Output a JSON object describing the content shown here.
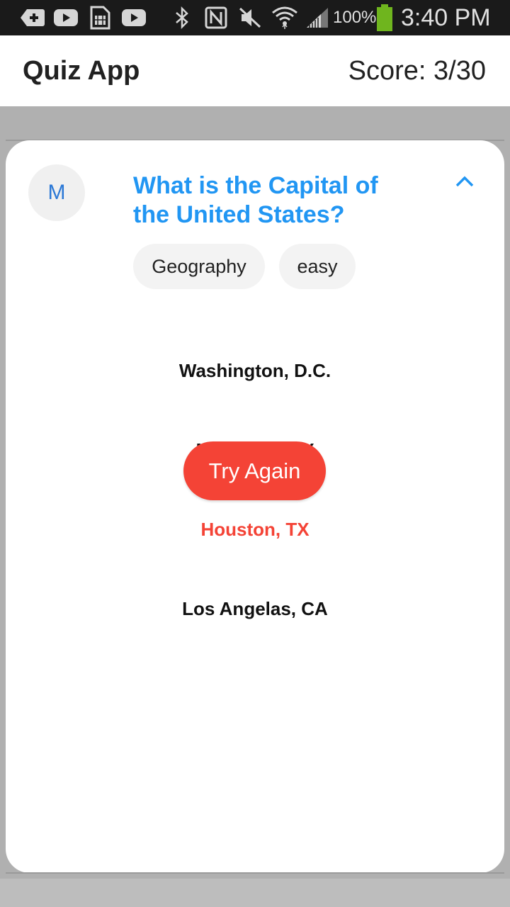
{
  "status_bar": {
    "icons": [
      "add-notification-icon",
      "youtube-icon",
      "sim-card-icon",
      "youtube-icon",
      "bluetooth-icon",
      "nfc-icon",
      "mute-icon",
      "wifi-icon",
      "signal-icon",
      "battery-icon"
    ],
    "battery_percent": "100%",
    "time": "3:40 PM"
  },
  "app_bar": {
    "title": "Quiz App",
    "score": "Score: 3/30"
  },
  "card": {
    "avatar_letter": "M",
    "question": "What is the Capital of the United States?",
    "chips": [
      "Geography",
      "easy"
    ],
    "answers": [
      "Washington, D.C.",
      "New York, NY",
      "Houston, TX",
      "Los Angelas, CA"
    ],
    "wrong_answer_color": "#f44336",
    "try_again_label": "Try Again"
  },
  "colors": {
    "accent": "#2196f3",
    "error": "#f44336",
    "battery": "#6fb51e"
  }
}
